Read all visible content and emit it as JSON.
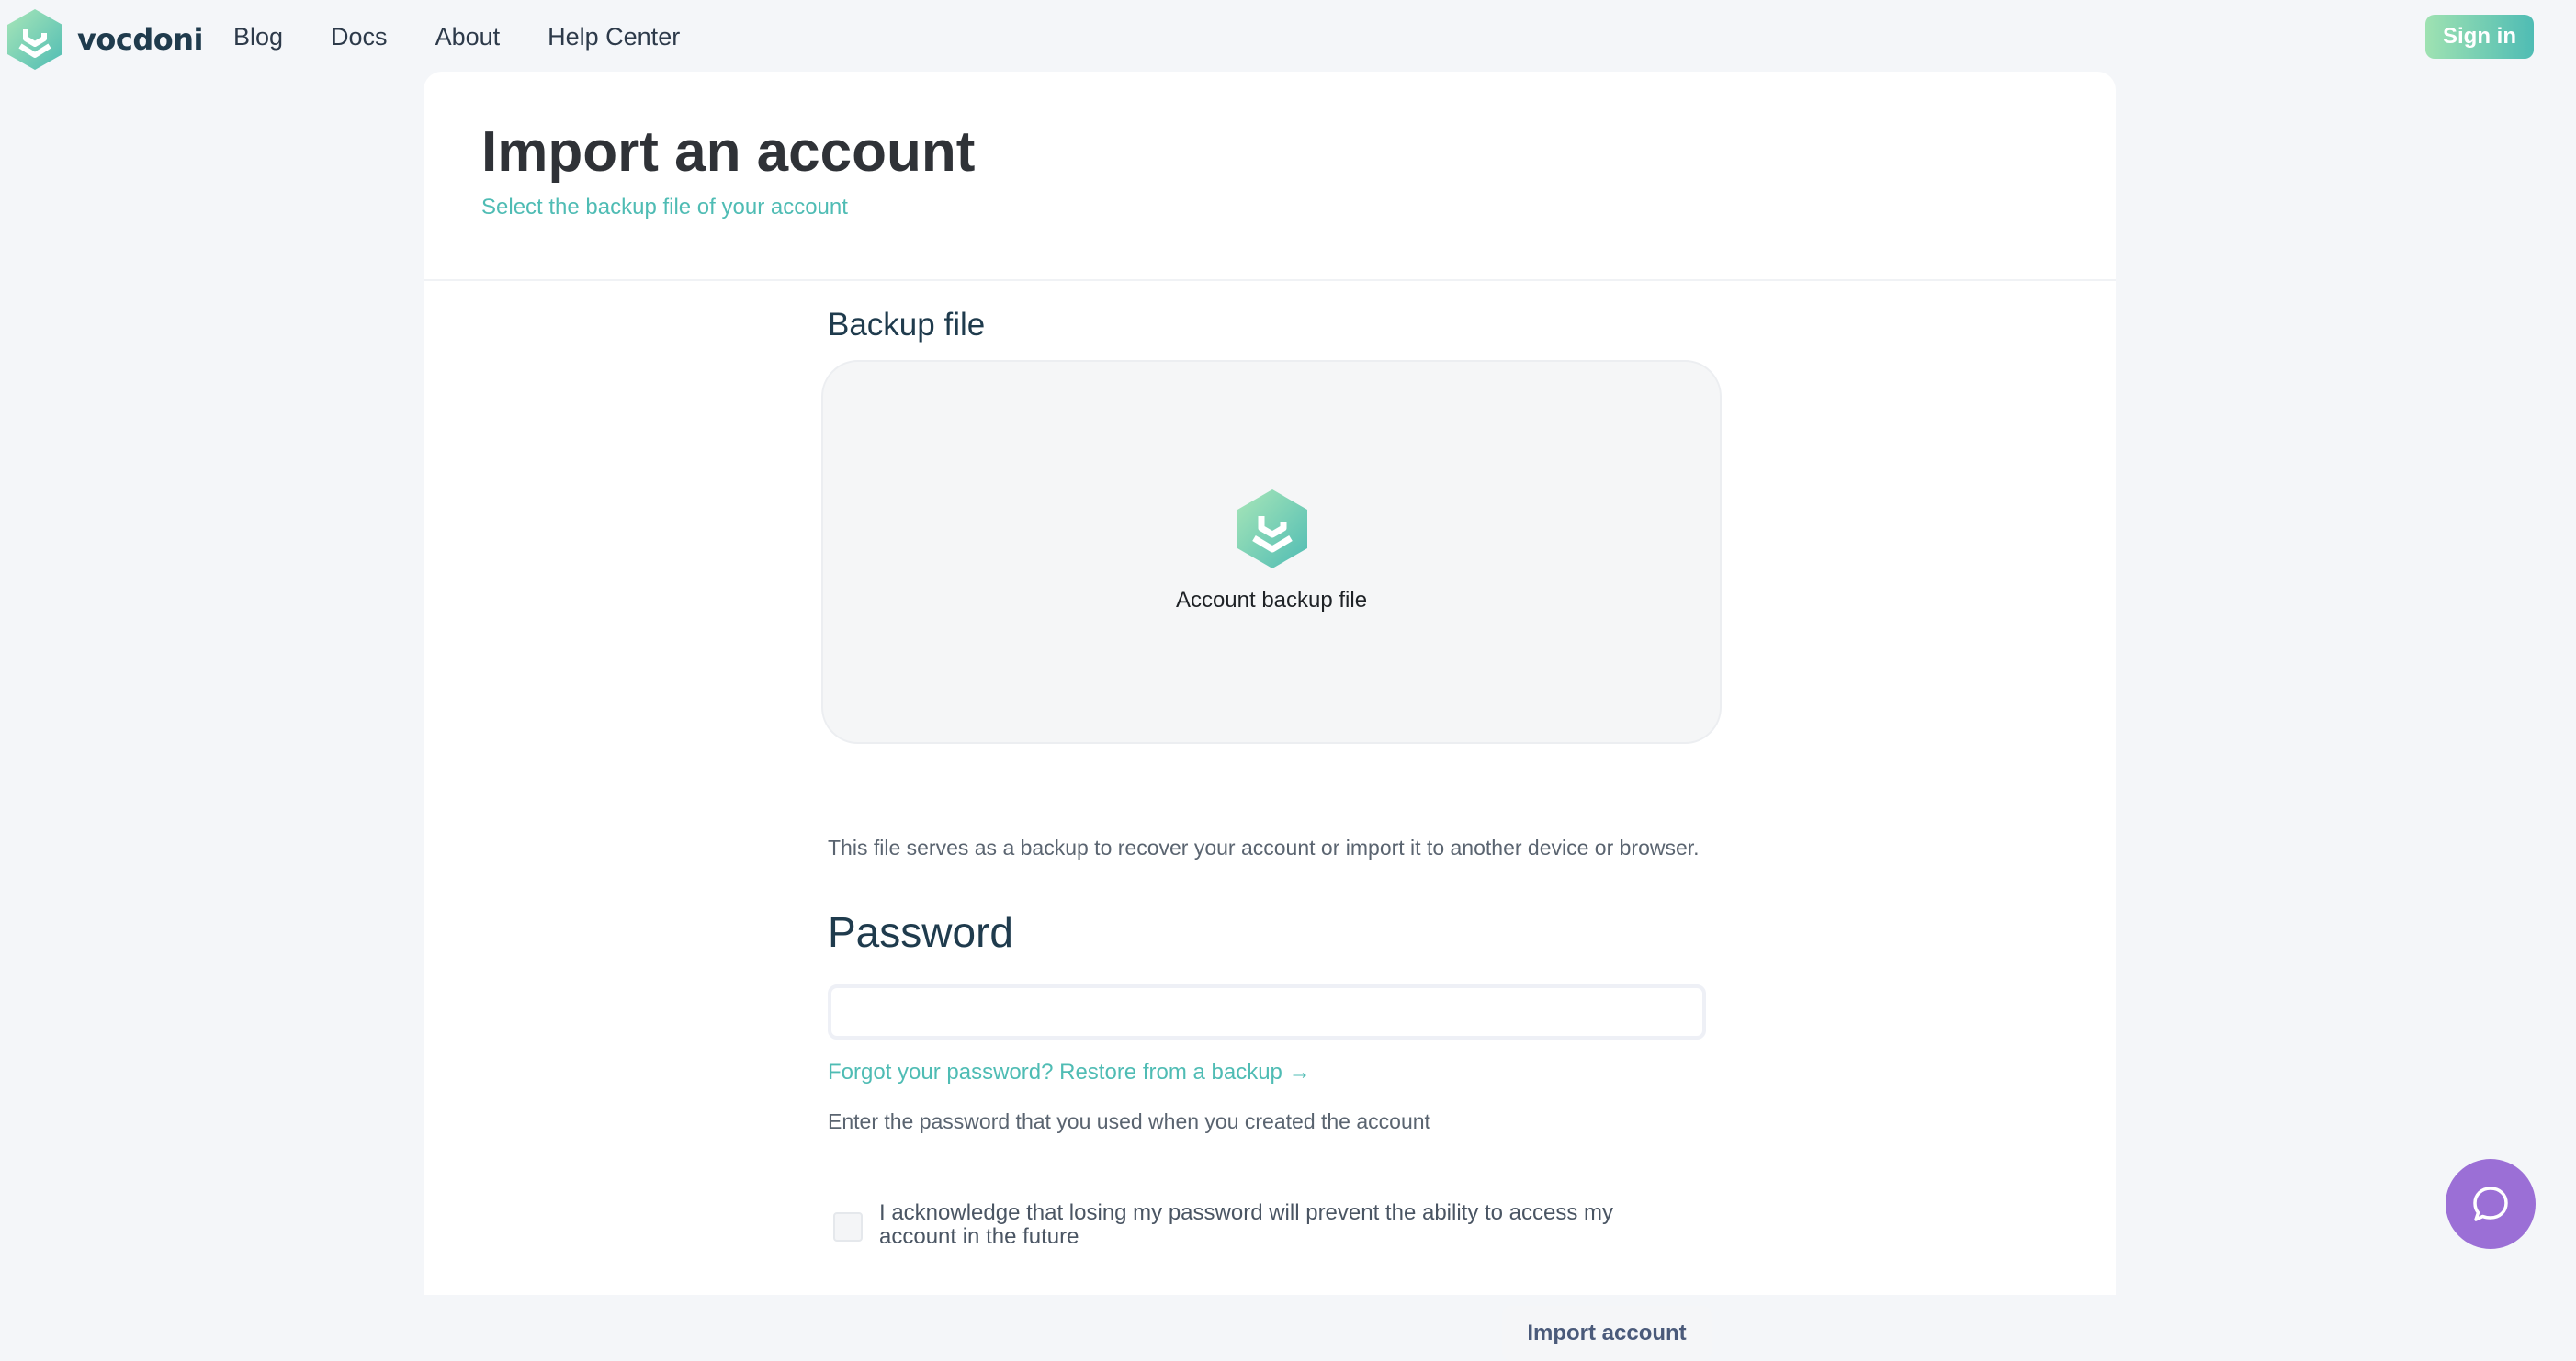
{
  "brand": {
    "name": "vocdoni",
    "logo_icon": "vocdoni-hexagon-logo",
    "accent": "#4fbcb4"
  },
  "nav": {
    "links": [
      "Blog",
      "Docs",
      "About",
      "Help Center"
    ],
    "signin_label": "Sign in"
  },
  "page": {
    "title": "Import an account",
    "subtitle": "Select the backup file of your account"
  },
  "backup": {
    "label": "Backup file",
    "dropzone_label": "Account backup file",
    "dropzone_icon": "vocdoni-file-icon",
    "help": "This file serves as a backup to recover your account or import it to another device or browser."
  },
  "password": {
    "label": "Password",
    "value": "",
    "forgot_link": "Forgot your password? Restore from a backup →",
    "help": "Enter the password that you used when you created the account"
  },
  "acknowledge": {
    "checked": false,
    "text": "I acknowledge that losing my password will prevent the ability to access my account in the future"
  },
  "actions": {
    "import_label": "Import account"
  },
  "chat": {
    "icon": "chat-bubble-icon",
    "color": "#9b6fd6"
  }
}
